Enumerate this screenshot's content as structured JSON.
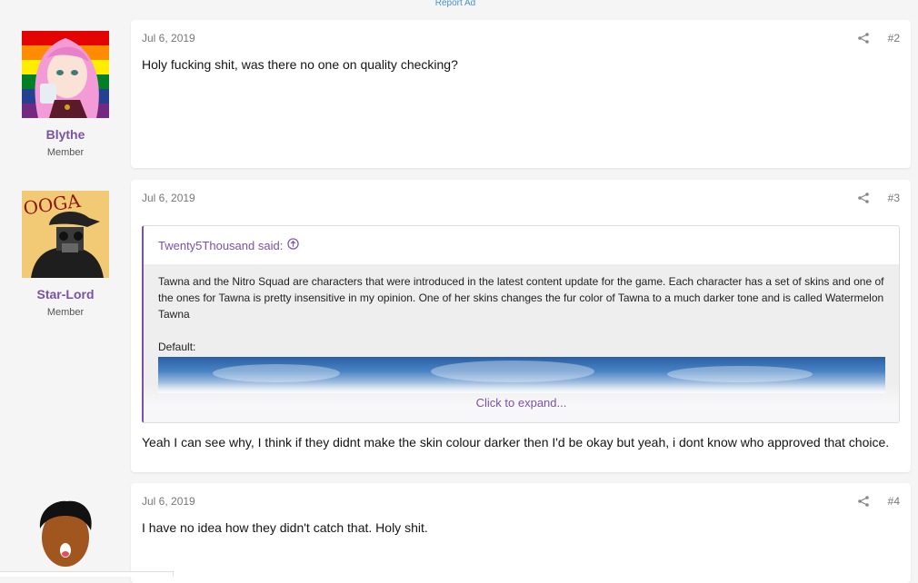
{
  "report_ad": "Report Ad",
  "posts": [
    {
      "user": {
        "name": "Blythe",
        "title": "Member",
        "avatar": "pink-haired-anime-character-rainbow-flag"
      },
      "date": "Jul 6, 2019",
      "number": "#2",
      "message": "Holy fucking shit, was there no one on quality checking?"
    },
    {
      "user": {
        "name": "Star-Lord",
        "title": "Member",
        "avatar": "masked-figure-ooga-sign"
      },
      "date": "Jul 6, 2019",
      "number": "#3",
      "quote": {
        "author": "Twenty5Thousand said:",
        "text": "Tawna and the Nitro Squad are characters that were introduced in the latest content update for the game. Each character has a set of skins and one of the ones for Tawna is pretty insensitive in my opinion. One of her skins changes the fur color of Tawna to a much darker tone and is called Watermelon Tawna",
        "default_label": "Default:",
        "expand_label": "Click to expand..."
      },
      "message": "Yeah I can see why, I think if they didnt make the skin colour darker then I'd be okay but yeah, i dont know who approved that choice."
    },
    {
      "user": {
        "avatar": "cartoon-face"
      },
      "date": "Jul 6, 2019",
      "number": "#4",
      "message": "I have no idea how they didn't catch that. Holy shit."
    }
  ],
  "colors": {
    "accent": "#7b52a8",
    "link": "#4a90c8"
  },
  "icons": [
    "share-icon",
    "arrow-up-circle-icon"
  ]
}
